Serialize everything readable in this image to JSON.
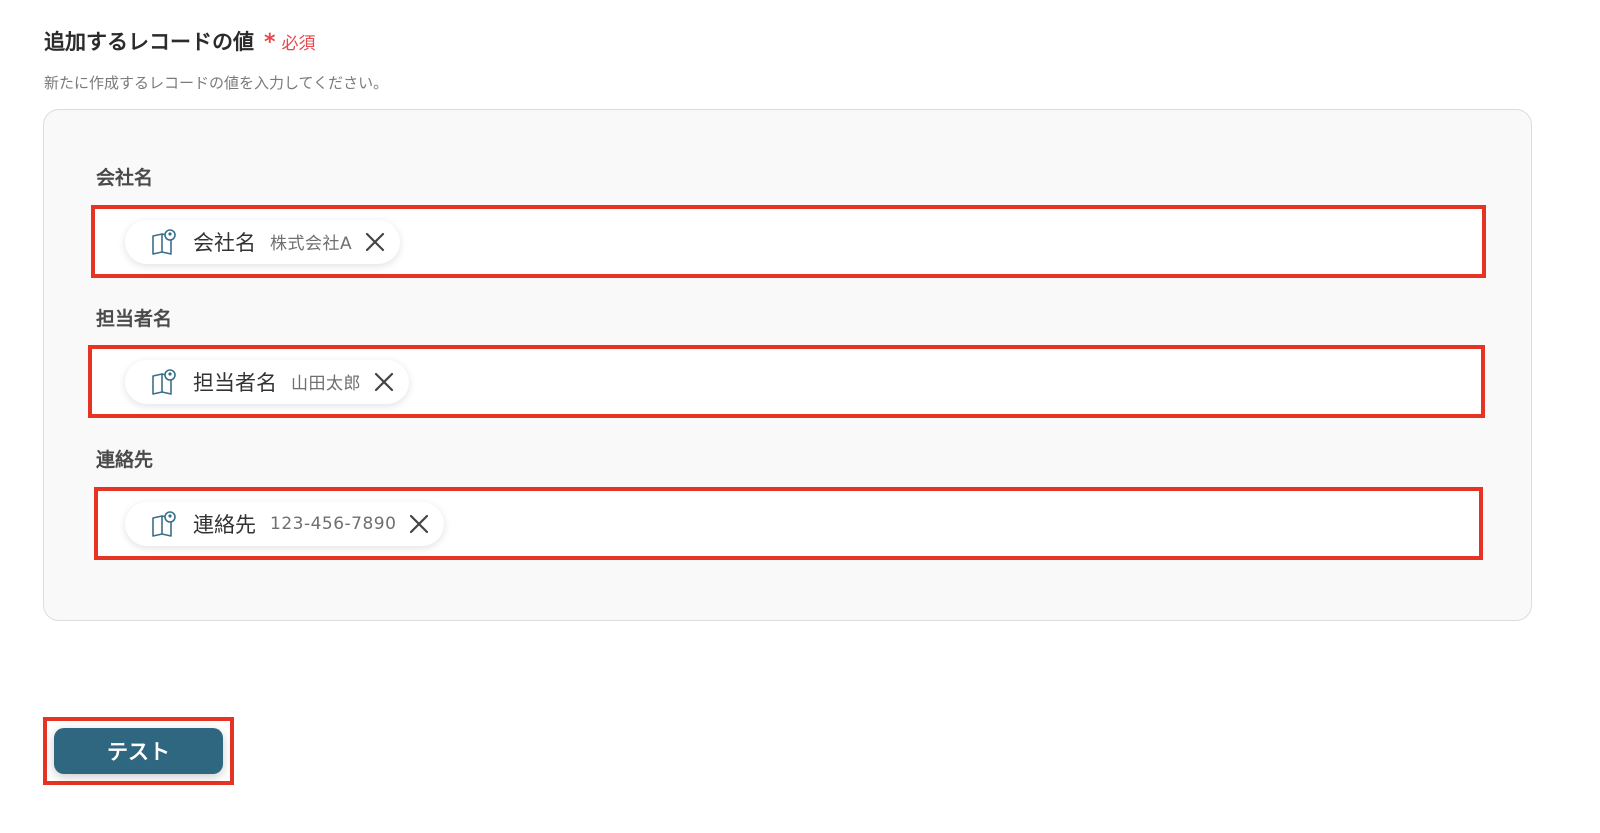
{
  "section": {
    "title": "追加するレコードの値",
    "required_mark": "*",
    "required_label": "必須",
    "description": "新たに作成するレコードの値を入力してください。"
  },
  "fields": [
    {
      "label": "会社名",
      "chip_name": "会社名",
      "chip_value": "株式会社A"
    },
    {
      "label": "担当者名",
      "chip_name": "担当者名",
      "chip_value": "山田太郎"
    },
    {
      "label": "連絡先",
      "chip_name": "連絡先",
      "chip_value": "123-456-7890"
    }
  ],
  "icons": {
    "chip_icon": "book-user-icon",
    "remove_icon": "close-icon"
  },
  "colors": {
    "accent_red": "#e53423",
    "required_red": "#e5484d",
    "button_bg": "#2f6780",
    "icon_blue": "#3a6f8a"
  },
  "actions": {
    "test_label": "テスト"
  }
}
